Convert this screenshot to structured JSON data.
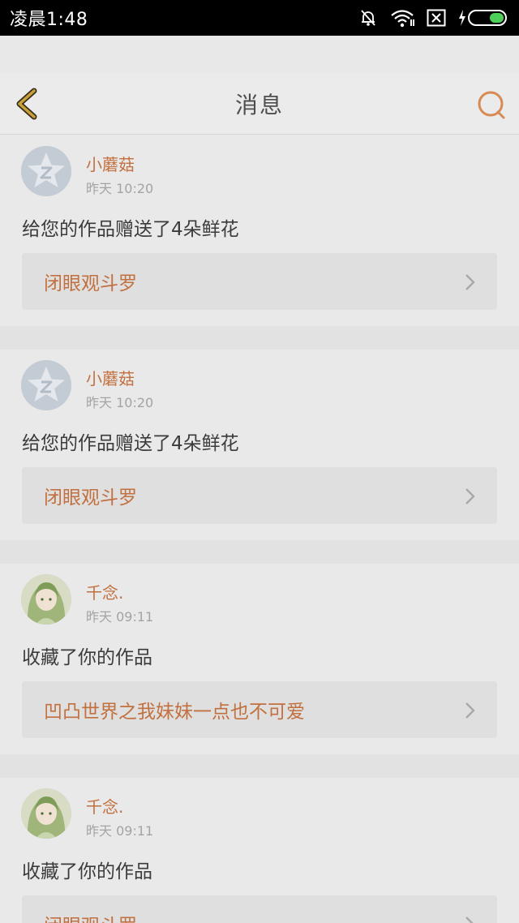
{
  "status_bar": {
    "time": "凌晨1:48"
  },
  "header": {
    "title": "消息",
    "back_icon": "chevron-left-icon",
    "search_icon": "search-icon"
  },
  "colors": {
    "accent": "#c2703f",
    "back_icon": "#c9a13a"
  },
  "messages": [
    {
      "name": "小蘑菇",
      "time": "昨天 10:20",
      "text": "给您的作品赠送了4朵鲜花",
      "work": "闭眼观斗罗",
      "avatar": "default-avatar"
    },
    {
      "name": "小蘑菇",
      "time": "昨天 10:20",
      "text": "给您的作品赠送了4朵鲜花",
      "work": "闭眼观斗罗",
      "avatar": "default-avatar"
    },
    {
      "name": "千念.",
      "time": "昨天 09:11",
      "text": "收藏了你的作品",
      "work": "凹凸世界之我妹妹一点也不可爱",
      "avatar": "anime-girl-avatar"
    },
    {
      "name": "千念.",
      "time": "昨天 09:11",
      "text": "收藏了你的作品",
      "work": "闭眼观斗罗",
      "avatar": "anime-girl-avatar"
    }
  ]
}
